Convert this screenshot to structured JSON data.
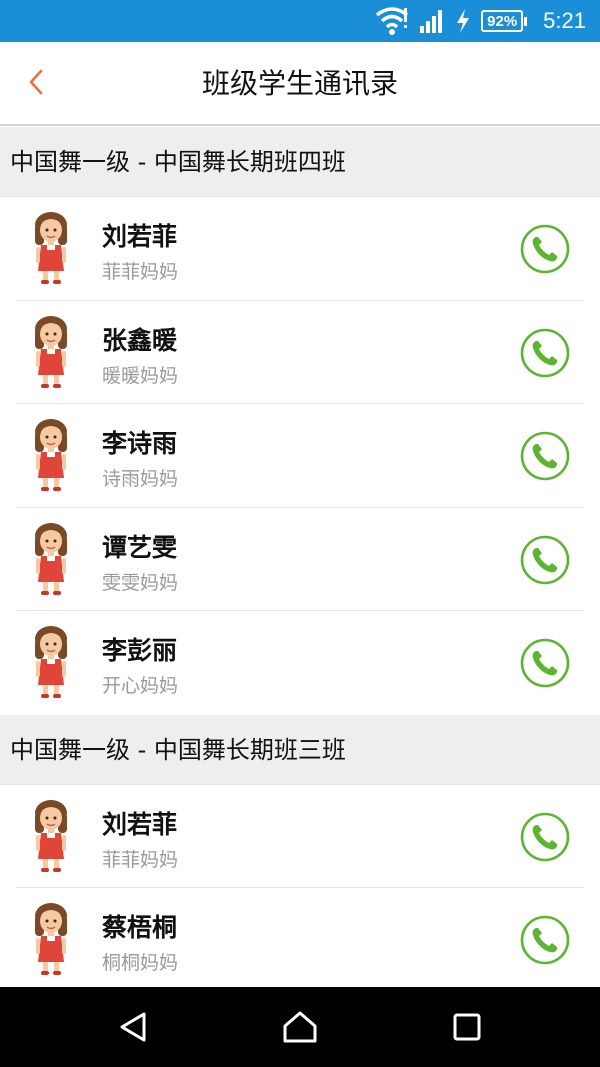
{
  "status_bar": {
    "battery": "92%",
    "time": "5:21",
    "icons": [
      "wifi-icon",
      "signal-icon",
      "charging-icon",
      "battery-icon"
    ]
  },
  "header": {
    "title": "班级学生通讯录",
    "back_icon": "chevron-left-icon"
  },
  "colors": {
    "status_bar": "#1a8fd8",
    "back_arrow": "#e8743a",
    "call_green": "#5cb531",
    "section_bg": "#eeeeee",
    "subtext": "#9a9a9a"
  },
  "sections": [
    {
      "title": "中国舞一级 - 中国舞长期班四班",
      "contacts": [
        {
          "name": "刘若菲",
          "relation": "菲菲妈妈"
        },
        {
          "name": "张鑫暖",
          "relation": "暖暖妈妈"
        },
        {
          "name": "李诗雨",
          "relation": "诗雨妈妈"
        },
        {
          "name": "谭艺雯",
          "relation": "雯雯妈妈"
        },
        {
          "name": "李彭丽",
          "relation": "开心妈妈"
        }
      ]
    },
    {
      "title": "中国舞一级 - 中国舞长期班三班",
      "contacts": [
        {
          "name": "刘若菲",
          "relation": "菲菲妈妈"
        },
        {
          "name": "蔡梧桐",
          "relation": "桐桐妈妈"
        }
      ]
    }
  ],
  "nav_bar": {
    "buttons": [
      "back-triangle-icon",
      "home-icon",
      "recents-square-icon"
    ]
  }
}
